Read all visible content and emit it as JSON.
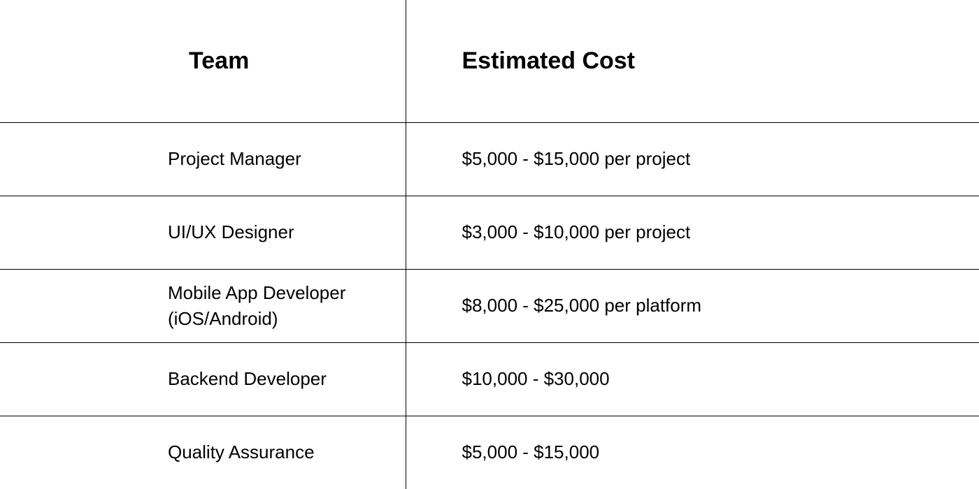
{
  "chart_data": {
    "type": "table",
    "columns": [
      "Team",
      "Estimated Cost"
    ],
    "rows": [
      {
        "team": "Project Manager",
        "cost": "$5,000 - $15,000 per project"
      },
      {
        "team": "UI/UX Designer",
        "cost": "$3,000 - $10,000 per project"
      },
      {
        "team": "Mobile App Developer (iOS/Android)",
        "cost": "$8,000 - $25,000 per platform"
      },
      {
        "team": "Backend Developer",
        "cost": "$10,000 - $30,000"
      },
      {
        "team": "Quality Assurance",
        "cost": "$5,000 - $15,000"
      }
    ]
  }
}
